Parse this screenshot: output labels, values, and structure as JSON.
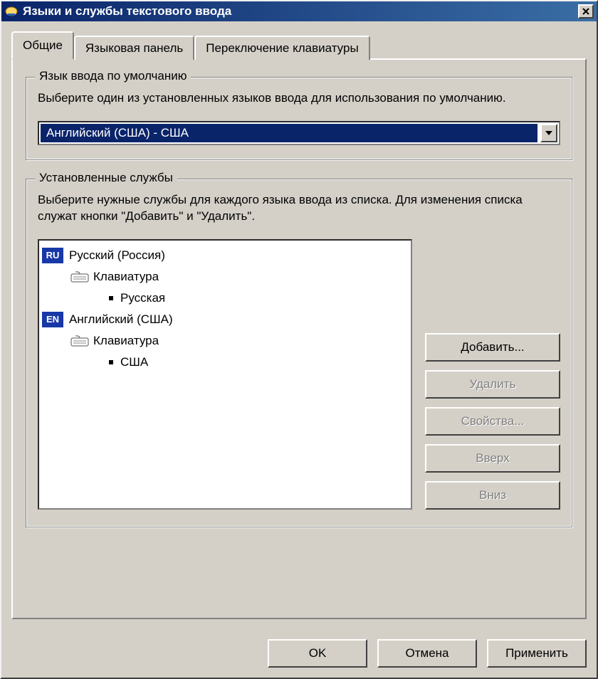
{
  "window": {
    "title": "Языки и службы текстового ввода"
  },
  "tabs": {
    "general": "Общие",
    "langbar": "Языковая панель",
    "switch": "Переключение клавиатуры"
  },
  "default_lang": {
    "group_title": "Язык ввода по умолчанию",
    "description": "Выберите один из установленных языков ввода для использования по умолчанию.",
    "selected": "Английский (США) - США"
  },
  "services": {
    "group_title": "Установленные службы",
    "description": "Выберите нужные службы для каждого языка ввода из списка. Для изменения списка служат кнопки \"Добавить\" и \"Удалить\".",
    "languages": [
      {
        "badge": "RU",
        "name": "Русский (Россия)",
        "kb_label": "Клавиатура",
        "layout": "Русская"
      },
      {
        "badge": "EN",
        "name": "Английский (США)",
        "kb_label": "Клавиатура",
        "layout": "США"
      }
    ],
    "buttons": {
      "add": "Добавить...",
      "remove": "Удалить",
      "properties": "Свойства...",
      "up": "Вверх",
      "down": "Вниз"
    }
  },
  "footer": {
    "ok": "OK",
    "cancel": "Отмена",
    "apply": "Применить"
  }
}
